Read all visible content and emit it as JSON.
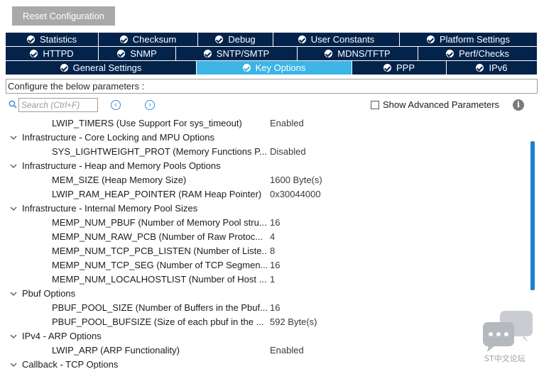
{
  "toolbar": {
    "reset_label": "Reset Configuration"
  },
  "tabs": {
    "row1": [
      {
        "label": "Statistics"
      },
      {
        "label": "Checksum"
      },
      {
        "label": "Debug"
      },
      {
        "label": "User Constants"
      },
      {
        "label": "Platform Settings"
      }
    ],
    "row2": [
      {
        "label": "HTTPD"
      },
      {
        "label": "SNMP"
      },
      {
        "label": "SNTP/SMTP"
      },
      {
        "label": "MDNS/TFTP"
      },
      {
        "label": "Perf/Checks"
      }
    ],
    "row3": [
      {
        "label": "General Settings"
      },
      {
        "label": "Key Options",
        "active": true
      },
      {
        "label": "PPP"
      },
      {
        "label": "IPv6"
      }
    ]
  },
  "description": "Configure the below parameters :",
  "search": {
    "placeholder": "Search (Ctrl+F)"
  },
  "advanced": {
    "label": "Show Advanced Parameters",
    "checked": false
  },
  "tree": {
    "rows": [
      {
        "type": "param",
        "name": "LWIP_TIMERS (Use Support For sys_timeout)",
        "value": "Enabled"
      },
      {
        "type": "group",
        "label": "Infrastructure - Core Locking and MPU Options"
      },
      {
        "type": "param",
        "name": "SYS_LIGHTWEIGHT_PROT (Memory Functions P...",
        "value": "Disabled"
      },
      {
        "type": "group",
        "label": "Infrastructure - Heap and Memory Pools Options"
      },
      {
        "type": "param",
        "name": "MEM_SIZE (Heap Memory Size)",
        "value": "1600 Byte(s)"
      },
      {
        "type": "param",
        "name": "LWIP_RAM_HEAP_POINTER (RAM Heap Pointer)",
        "value": "0x30044000"
      },
      {
        "type": "group",
        "label": "Infrastructure - Internal Memory Pool Sizes"
      },
      {
        "type": "param",
        "name": "MEMP_NUM_PBUF (Number of Memory Pool stru...",
        "value": "16"
      },
      {
        "type": "param",
        "name": "MEMP_NUM_RAW_PCB (Number of Raw Protoc...",
        "value": "4"
      },
      {
        "type": "param",
        "name": "MEMP_NUM_TCP_PCB_LISTEN (Number of Liste...",
        "value": "8"
      },
      {
        "type": "param",
        "name": "MEMP_NUM_TCP_SEG (Number of TCP Segmen...",
        "value": "16"
      },
      {
        "type": "param",
        "name": "MEMP_NUM_LOCALHOSTLIST (Number of Host ...",
        "value": "1"
      },
      {
        "type": "group",
        "label": "Pbuf Options"
      },
      {
        "type": "param",
        "name": "PBUF_POOL_SIZE (Number of Buffers in the Pbuf...",
        "value": "16"
      },
      {
        "type": "param",
        "name": "PBUF_POOL_BUFSIZE (Size of each pbuf in the ...",
        "value": "592 Byte(s)"
      },
      {
        "type": "group",
        "label": "IPv4 - ARP Options"
      },
      {
        "type": "param",
        "name": "LWIP_ARP (ARP Functionality)",
        "value": "Enabled"
      },
      {
        "type": "group",
        "label": "Callback - TCP Options"
      }
    ]
  },
  "watermark": {
    "text": "ST中文论坛"
  },
  "colors": {
    "tab_bg": "#03234b",
    "tab_active": "#3cb4e6",
    "scroll_thumb": "#1f7fd1"
  }
}
